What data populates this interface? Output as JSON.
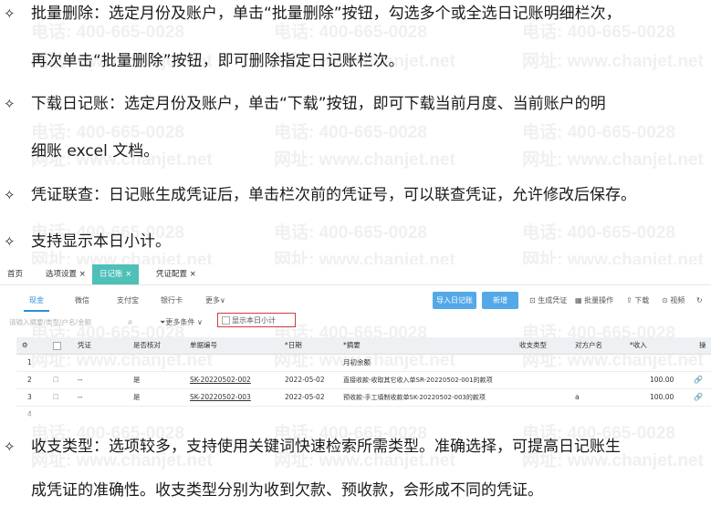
{
  "watermark": {
    "phone": "电话: 400-665-0028",
    "site": "网址: www.chanjet.net"
  },
  "bullet_symbol": "✧",
  "paragraphs": [
    {
      "lines": [
        "批量删除：选定月份及账户，单击“批量删除”按钮，勾选多个或全选日记账明细栏次，",
        "再次单击“批量删除”按钮，即可删除指定日记账栏次。"
      ]
    },
    {
      "lines": [
        "下载日记账：选定月份及账户，单击“下载”按钮，即可下载当前月度、当前账户的明",
        "细账 excel 文档。"
      ]
    },
    {
      "lines": [
        "凭证联查：日记账生成凭证后，单击栏次前的凭证号，可以联查凭证，允许修改后保存。"
      ]
    },
    {
      "lines": [
        "支持显示本日小计。"
      ]
    }
  ],
  "app": {
    "tabs": [
      "首页",
      "选项设置 ×",
      "日记账 ×",
      "凭证配置 ×"
    ],
    "sub_tabs": [
      "现金",
      "微信",
      "支付宝",
      "银行卡",
      "更多∨"
    ],
    "buttons": {
      "import": "导入日记账",
      "new": "新增"
    },
    "tools": [
      "⊡ 生成凭证",
      "▦ 批量操作",
      "⇪ 下载",
      "⊙ 视频",
      "↻"
    ],
    "search_placeholder": "请输入摘要/类型/户名/金额",
    "more_conditions": "⏷更多条件 ∨",
    "show_day_subtotal": "显示本日小计",
    "columns": [
      "⚙",
      "",
      "凭证",
      "是否核对",
      "单据编号",
      "*日期",
      "*摘要",
      "收支类型",
      "对方户名",
      "*收入",
      "操"
    ],
    "rows": [
      [
        "1",
        "",
        "",
        "",
        "",
        "",
        "月初余额",
        "",
        "",
        "",
        ""
      ],
      [
        "2",
        "☐",
        "--",
        "是",
        "SK-20220502-002",
        "2022-05-02",
        "直接收款-收取其它收入单SR-20220502-001的款项",
        "",
        "",
        "100.00",
        "🔗"
      ],
      [
        "3",
        "☐",
        "--",
        "是",
        "SK-20220502-003",
        "2022-05-02",
        "预收款-手工填制收款单SK-20220502-003的款项",
        "",
        "a",
        "100.00",
        "🔗"
      ],
      [
        "4",
        "",
        "",
        "",
        "",
        "",
        "",
        "",
        "",
        "",
        ""
      ]
    ]
  },
  "paragraph_after": {
    "lines": [
      "收支类型：选项较多，支持使用关键词快速检索所需类型。准确选择，可提高日记账生",
      "成凭证的准确性。收支类型分别为收到欠款、预收款，会形成不同的凭证。"
    ]
  }
}
